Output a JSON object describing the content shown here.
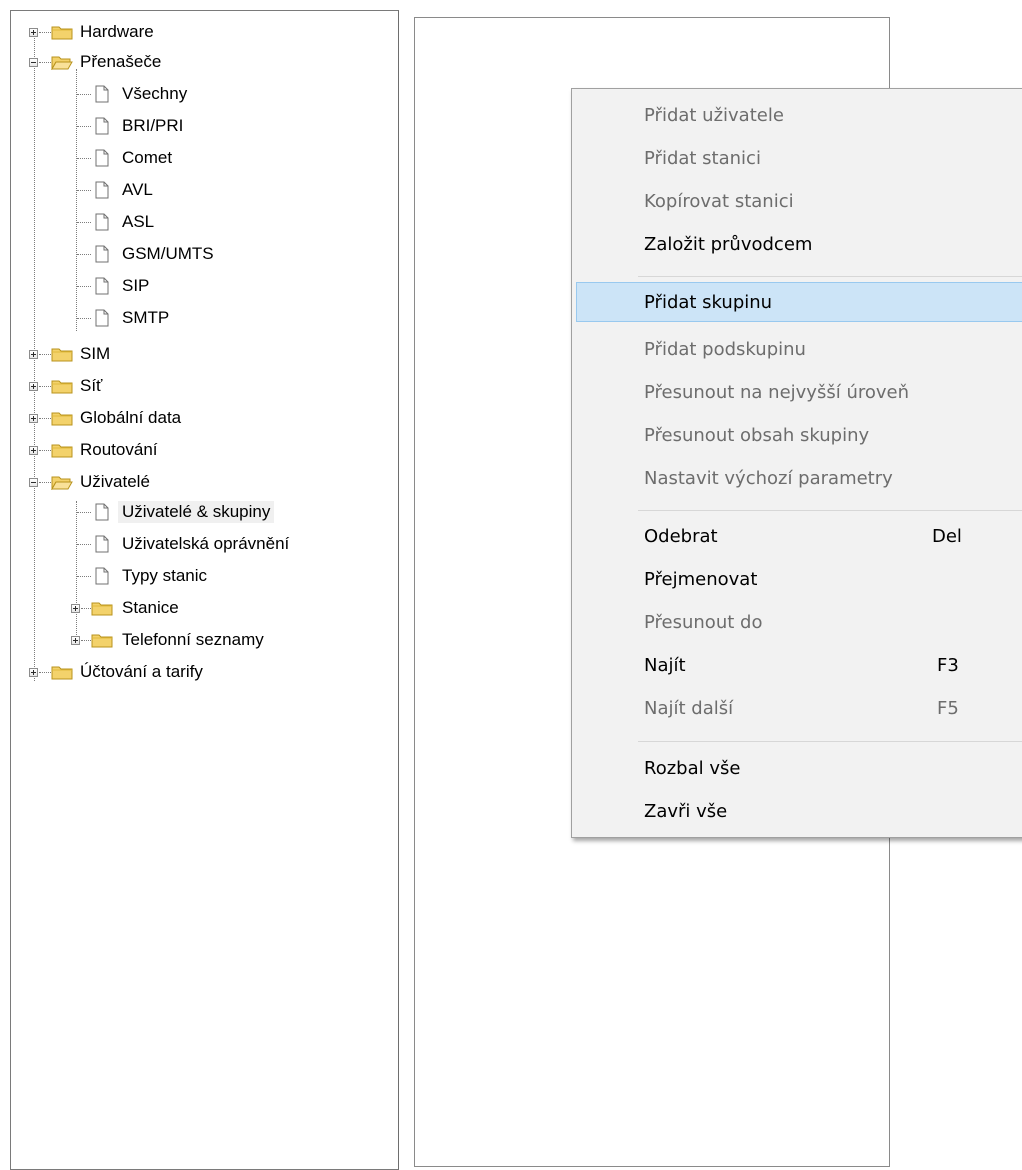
{
  "tree": {
    "nodes": [
      {
        "label": "Hardware",
        "icon": "folder-closed-icon",
        "expander": "plus"
      },
      {
        "label": "Přenašeče",
        "icon": "folder-open-icon",
        "expander": "minus"
      },
      {
        "label": "Všechny",
        "icon": "document-icon"
      },
      {
        "label": "BRI/PRI",
        "icon": "document-icon"
      },
      {
        "label": "Comet",
        "icon": "document-icon"
      },
      {
        "label": "AVL",
        "icon": "document-icon"
      },
      {
        "label": "ASL",
        "icon": "document-icon"
      },
      {
        "label": "GSM/UMTS",
        "icon": "document-icon"
      },
      {
        "label": "SIP",
        "icon": "document-icon"
      },
      {
        "label": "SMTP",
        "icon": "document-icon"
      },
      {
        "label": "SIM",
        "icon": "folder-closed-icon",
        "expander": "plus"
      },
      {
        "label": "Síť",
        "icon": "folder-closed-icon",
        "expander": "plus"
      },
      {
        "label": "Globální data",
        "icon": "folder-closed-icon",
        "expander": "plus"
      },
      {
        "label": "Routování",
        "icon": "folder-closed-icon",
        "expander": "plus"
      },
      {
        "label": "Uživatelé",
        "icon": "folder-open-icon",
        "expander": "minus"
      },
      {
        "label": "Uživatelé & skupiny",
        "icon": "document-icon",
        "selected": true
      },
      {
        "label": "Uživatelská oprávnění",
        "icon": "document-icon"
      },
      {
        "label": "Typy stanic",
        "icon": "document-icon"
      },
      {
        "label": "Stanice",
        "icon": "folder-closed-icon",
        "expander": "plus"
      },
      {
        "label": "Telefonní seznamy",
        "icon": "folder-closed-icon",
        "expander": "plus"
      },
      {
        "label": "Účtování a tarify",
        "icon": "folder-closed-icon",
        "expander": "plus"
      }
    ]
  },
  "context_menu": {
    "items": [
      {
        "label": "Přidat uživatele",
        "enabled": false
      },
      {
        "label": "Přidat stanici",
        "enabled": false
      },
      {
        "label": "Kopírovat stanici",
        "enabled": false
      },
      {
        "label": "Založit průvodcem",
        "enabled": true
      },
      {
        "label": "Přidat skupinu",
        "enabled": true,
        "highlighted": true
      },
      {
        "label": "Přidat podskupinu",
        "enabled": false
      },
      {
        "label": "Přesunout na nejvyšší úroveň",
        "enabled": false
      },
      {
        "label": "Přesunout obsah skupiny",
        "enabled": false
      },
      {
        "label": "Nastavit výchozí parametry",
        "enabled": false
      },
      {
        "label": "Odebrat",
        "shortcut": "Del",
        "enabled": true
      },
      {
        "label": "Přejmenovat",
        "enabled": true
      },
      {
        "label": "Přesunout do",
        "enabled": false
      },
      {
        "label": "Najít",
        "shortcut": "F3",
        "enabled": true
      },
      {
        "label": "Najít další",
        "shortcut": "F5",
        "enabled": false
      },
      {
        "label": "Rozbal vše",
        "enabled": true
      },
      {
        "label": "Zavři vše",
        "enabled": true
      }
    ]
  },
  "colors": {
    "highlight_bg": "#cce4f7",
    "disabled_text": "#6d6d6d",
    "folder_yellow": "#f3d26b"
  }
}
